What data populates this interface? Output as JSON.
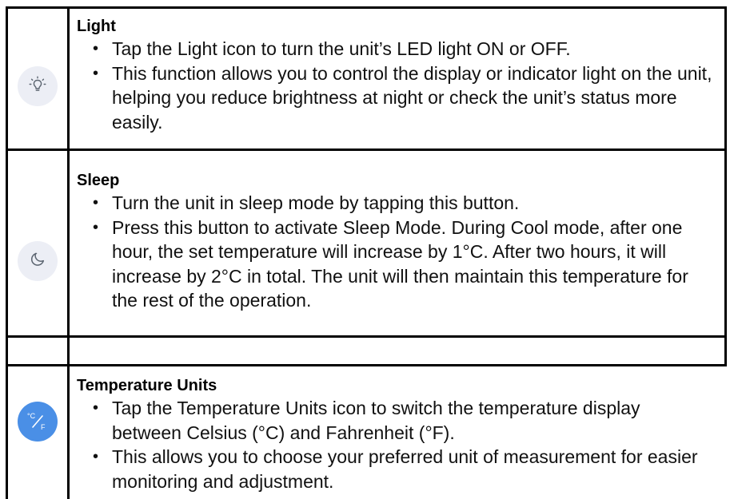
{
  "rows": [
    {
      "icon": "lightbulb-icon",
      "heading": "Light",
      "bullets": [
        "Tap the Light icon to turn the unit’s LED light ON or OFF.",
        "This function allows you to control the display or indicator light on the unit, helping you reduce brightness at night or check the unit’s status more easily."
      ]
    },
    {
      "icon": "moon-icon",
      "heading": "Sleep",
      "bullets": [
        "Turn the unit in sleep mode by tapping this button.",
        "Press this button to activate Sleep Mode. During Cool mode, after one hour, the set temperature will increase by 1°C. After two hours, it will increase by 2°C in total. The unit will then maintain this temperature for the rest of the operation."
      ]
    },
    {
      "icon": "celsius-fahrenheit-icon",
      "icon_text_c": "°C",
      "icon_text_f": "F",
      "heading": "Temperature Units",
      "bullets": [
        "Tap the Temperature Units icon to switch the temperature display between Celsius (°C) and Fahrenheit (°F).",
        "This allows you to choose your preferred unit of measurement for easier monitoring and adjustment."
      ]
    }
  ],
  "colors": {
    "border": "#000000",
    "icon_bg": "#eceef5",
    "icon_bg_active": "#4a8fe6",
    "icon_stroke": "#5b6470"
  }
}
